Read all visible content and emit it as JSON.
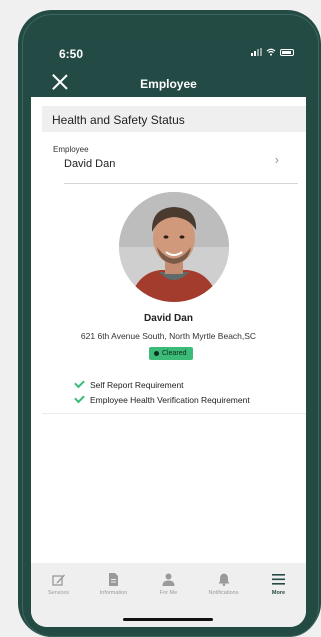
{
  "status_bar": {
    "time": "6:50"
  },
  "header": {
    "title": "Employee"
  },
  "section": {
    "title": "Health and Safety Status"
  },
  "employee_field": {
    "label": "Employee",
    "value": "David Dan"
  },
  "profile": {
    "name": "David Dan",
    "address": "621 6th Avenue South, North Myrtle Beach,SC",
    "status": "Cleared"
  },
  "requirements": [
    "Self Report Requirement",
    "Employee Health Verification Requirement"
  ],
  "tabs": [
    {
      "label": "Services",
      "icon": "edit-icon"
    },
    {
      "label": "Information",
      "icon": "document-icon"
    },
    {
      "label": "For Me",
      "icon": "person-icon"
    },
    {
      "label": "Notifications",
      "icon": "bell-icon"
    },
    {
      "label": "More",
      "icon": "menu-icon",
      "active": true
    }
  ],
  "colors": {
    "brand": "#244a44",
    "accent": "#3cba78"
  }
}
